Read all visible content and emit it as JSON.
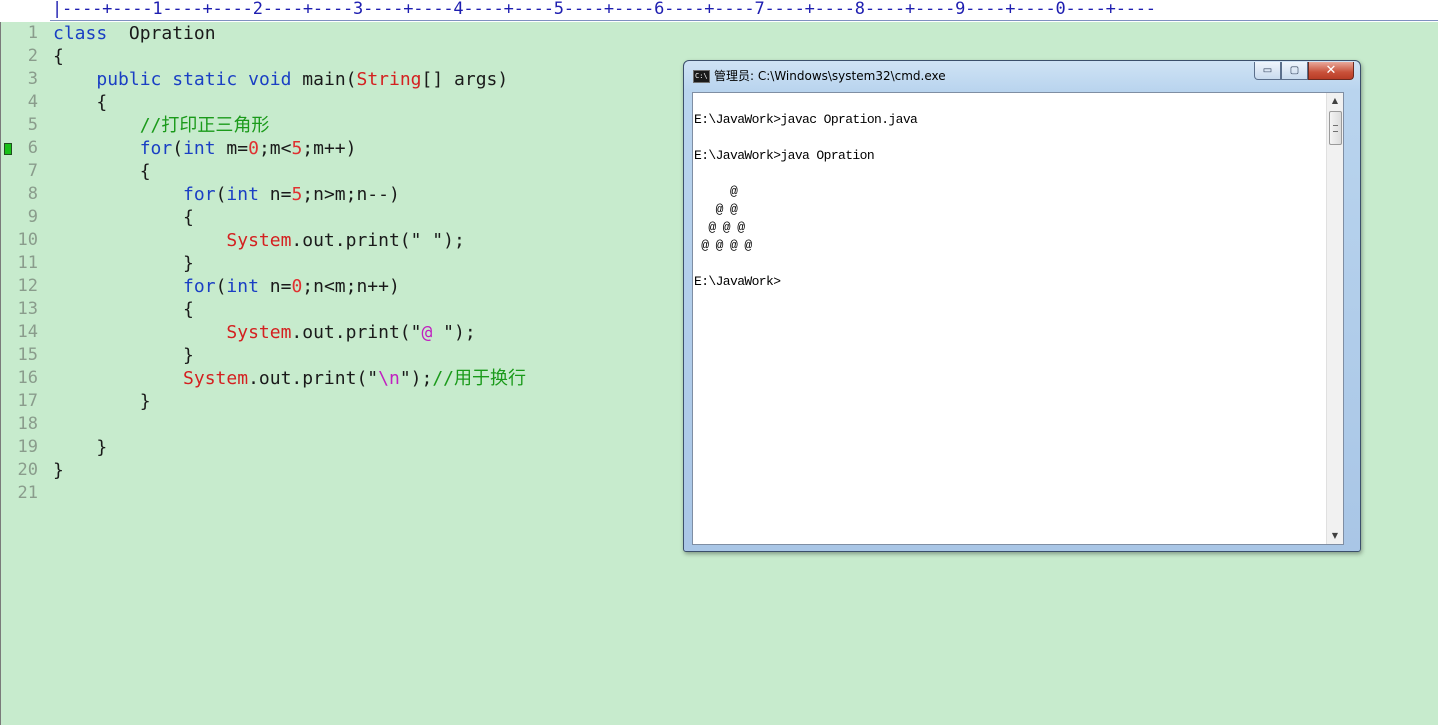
{
  "ruler": {
    "scale": "|----+----1----+----2----+----3----+----4----+----5----+----6----+----7----+----8----+----9----+----0----+----"
  },
  "editor": {
    "lines": [
      {
        "n": "1",
        "segments": [
          {
            "t": "class",
            "c": "kw"
          },
          {
            "t": "  Opration",
            "c": ""
          }
        ]
      },
      {
        "n": "2",
        "segments": [
          {
            "t": "{",
            "c": ""
          }
        ]
      },
      {
        "n": "3",
        "segments": [
          {
            "t": "    ",
            "c": ""
          },
          {
            "t": "public",
            "c": "kw"
          },
          {
            "t": " ",
            "c": ""
          },
          {
            "t": "static",
            "c": "kw"
          },
          {
            "t": " ",
            "c": ""
          },
          {
            "t": "void",
            "c": "kw"
          },
          {
            "t": " main(",
            "c": ""
          },
          {
            "t": "String",
            "c": "cls"
          },
          {
            "t": "[] args)",
            "c": ""
          }
        ]
      },
      {
        "n": "4",
        "segments": [
          {
            "t": "    {",
            "c": ""
          }
        ]
      },
      {
        "n": "5",
        "segments": [
          {
            "t": "        ",
            "c": ""
          },
          {
            "t": "//打印正三角形",
            "c": "cmt"
          }
        ]
      },
      {
        "n": "6",
        "marker": true,
        "segments": [
          {
            "t": "        ",
            "c": ""
          },
          {
            "t": "for",
            "c": "kw"
          },
          {
            "t": "(",
            "c": ""
          },
          {
            "t": "int",
            "c": "kw"
          },
          {
            "t": " m=",
            "c": ""
          },
          {
            "t": "0",
            "c": "num"
          },
          {
            "t": ";m<",
            "c": ""
          },
          {
            "t": "5",
            "c": "num"
          },
          {
            "t": ";m++)",
            "c": ""
          }
        ]
      },
      {
        "n": "7",
        "segments": [
          {
            "t": "        {",
            "c": ""
          }
        ]
      },
      {
        "n": "8",
        "segments": [
          {
            "t": "            ",
            "c": ""
          },
          {
            "t": "for",
            "c": "kw"
          },
          {
            "t": "(",
            "c": ""
          },
          {
            "t": "int",
            "c": "kw"
          },
          {
            "t": " n=",
            "c": ""
          },
          {
            "t": "5",
            "c": "num"
          },
          {
            "t": ";n>m;n--)",
            "c": ""
          }
        ]
      },
      {
        "n": "9",
        "segments": [
          {
            "t": "            {",
            "c": ""
          }
        ]
      },
      {
        "n": "10",
        "segments": [
          {
            "t": "                ",
            "c": ""
          },
          {
            "t": "System",
            "c": "cls"
          },
          {
            "t": ".out.print(\" \");",
            "c": ""
          }
        ]
      },
      {
        "n": "11",
        "segments": [
          {
            "t": "            }",
            "c": ""
          }
        ]
      },
      {
        "n": "12",
        "segments": [
          {
            "t": "            ",
            "c": ""
          },
          {
            "t": "for",
            "c": "kw"
          },
          {
            "t": "(",
            "c": ""
          },
          {
            "t": "int",
            "c": "kw"
          },
          {
            "t": " n=",
            "c": ""
          },
          {
            "t": "0",
            "c": "num"
          },
          {
            "t": ";n<m;n++)",
            "c": ""
          }
        ]
      },
      {
        "n": "13",
        "segments": [
          {
            "t": "            {",
            "c": ""
          }
        ]
      },
      {
        "n": "14",
        "segments": [
          {
            "t": "                ",
            "c": ""
          },
          {
            "t": "System",
            "c": "cls"
          },
          {
            "t": ".out.print(\"",
            "c": ""
          },
          {
            "t": "@",
            "c": "esc"
          },
          {
            "t": " \");",
            "c": ""
          }
        ]
      },
      {
        "n": "15",
        "segments": [
          {
            "t": "            }",
            "c": ""
          }
        ]
      },
      {
        "n": "16",
        "segments": [
          {
            "t": "            ",
            "c": ""
          },
          {
            "t": "System",
            "c": "cls"
          },
          {
            "t": ".out.print(\"",
            "c": ""
          },
          {
            "t": "\\n",
            "c": "esc"
          },
          {
            "t": "\");",
            "c": ""
          },
          {
            "t": "//用于换行",
            "c": "cmt"
          }
        ]
      },
      {
        "n": "17",
        "segments": [
          {
            "t": "        }",
            "c": ""
          }
        ]
      },
      {
        "n": "18",
        "segments": []
      },
      {
        "n": "19",
        "segments": [
          {
            "t": "    }",
            "c": ""
          }
        ]
      },
      {
        "n": "20",
        "segments": [
          {
            "t": "}",
            "c": ""
          }
        ]
      },
      {
        "n": "21",
        "segments": []
      }
    ]
  },
  "cmd": {
    "icon_label": "C:\\",
    "title": "管理员: C:\\Windows\\system32\\cmd.exe",
    "buttons": {
      "minimize": "▭",
      "maximize": "▢",
      "close": "✕"
    },
    "output": [
      "",
      "E:\\JavaWork>javac Opration.java",
      "",
      "E:\\JavaWork>java Opration",
      "",
      "     @",
      "   @ @",
      "  @ @ @",
      " @ @ @ @",
      "",
      "E:\\JavaWork>"
    ],
    "scroll": {
      "up": "▲",
      "down": "▼"
    }
  }
}
